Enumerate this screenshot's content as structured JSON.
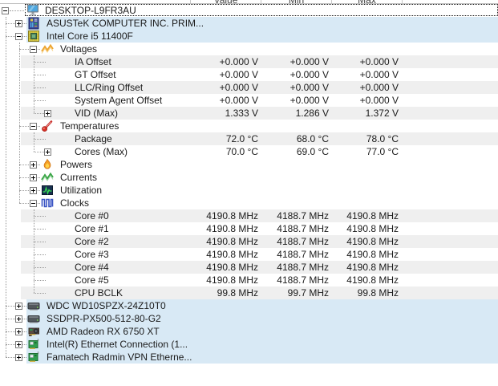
{
  "header": {
    "columns": [
      "Value",
      "Min",
      "Max"
    ]
  },
  "colors": {
    "row_highlight": "#d8e9f5",
    "row_stripe": "#efefef",
    "header_border": "#bdbdbd",
    "tree_line": "#9a9a9a",
    "focus_outline": "#1a1a1a"
  },
  "tree": {
    "rows": [
      {
        "level": 0,
        "expander": "minus",
        "icon": "monitor-icon",
        "label": "DESKTOP-L9FR3AU",
        "values": [],
        "selected": true
      },
      {
        "level": 1,
        "expander": "plus",
        "icon": "motherboard-icon",
        "label": "ASUSTeK COMPUTER INC. PRIM...",
        "values": []
      },
      {
        "level": 1,
        "expander": "minus",
        "icon": "cpu-icon",
        "label": "Intel Core i5 11400F",
        "values": []
      },
      {
        "level": 2,
        "expander": "minus",
        "icon": "voltage-icon",
        "label": "Voltages",
        "values": []
      },
      {
        "level": 3,
        "expander": null,
        "icon": null,
        "label": "IA Offset",
        "values": [
          "+0.000 V",
          "+0.000 V",
          "+0.000 V"
        ]
      },
      {
        "level": 3,
        "expander": null,
        "icon": null,
        "label": "GT Offset",
        "values": [
          "+0.000 V",
          "+0.000 V",
          "+0.000 V"
        ]
      },
      {
        "level": 3,
        "expander": null,
        "icon": null,
        "label": "LLC/Ring Offset",
        "values": [
          "+0.000 V",
          "+0.000 V",
          "+0.000 V"
        ]
      },
      {
        "level": 3,
        "expander": null,
        "icon": null,
        "label": "System Agent Offset",
        "values": [
          "+0.000 V",
          "+0.000 V",
          "+0.000 V"
        ]
      },
      {
        "level": 3,
        "expander": "plus",
        "icon": null,
        "label": "VID (Max)",
        "values": [
          "1.333 V",
          "1.286 V",
          "1.372 V"
        ]
      },
      {
        "level": 2,
        "expander": "minus",
        "icon": "thermometer-icon",
        "label": "Temperatures",
        "values": []
      },
      {
        "level": 3,
        "expander": null,
        "icon": null,
        "label": "Package",
        "values": [
          "72.0 °C",
          "68.0 °C",
          "78.0 °C"
        ]
      },
      {
        "level": 3,
        "expander": "plus",
        "icon": null,
        "label": "Cores (Max)",
        "values": [
          "70.0 °C",
          "69.0 °C",
          "77.0 °C"
        ]
      },
      {
        "level": 2,
        "expander": "plus",
        "icon": "flame-icon",
        "label": "Powers",
        "values": []
      },
      {
        "level": 2,
        "expander": "plus",
        "icon": "current-icon",
        "label": "Currents",
        "values": []
      },
      {
        "level": 2,
        "expander": "plus",
        "icon": "utilization-icon",
        "label": "Utilization",
        "values": []
      },
      {
        "level": 2,
        "expander": "minus",
        "icon": "clock-wave-icon",
        "label": "Clocks",
        "values": []
      },
      {
        "level": 3,
        "expander": null,
        "icon": null,
        "label": "Core #0",
        "values": [
          "4190.8 MHz",
          "4188.7 MHz",
          "4190.8 MHz"
        ]
      },
      {
        "level": 3,
        "expander": null,
        "icon": null,
        "label": "Core #1",
        "values": [
          "4190.8 MHz",
          "4188.7 MHz",
          "4190.8 MHz"
        ]
      },
      {
        "level": 3,
        "expander": null,
        "icon": null,
        "label": "Core #2",
        "values": [
          "4190.8 MHz",
          "4188.7 MHz",
          "4190.8 MHz"
        ]
      },
      {
        "level": 3,
        "expander": null,
        "icon": null,
        "label": "Core #3",
        "values": [
          "4190.8 MHz",
          "4188.7 MHz",
          "4190.8 MHz"
        ]
      },
      {
        "level": 3,
        "expander": null,
        "icon": null,
        "label": "Core #4",
        "values": [
          "4190.8 MHz",
          "4188.7 MHz",
          "4190.8 MHz"
        ]
      },
      {
        "level": 3,
        "expander": null,
        "icon": null,
        "label": "Core #5",
        "values": [
          "4190.8 MHz",
          "4188.7 MHz",
          "4190.8 MHz"
        ]
      },
      {
        "level": 3,
        "expander": null,
        "icon": null,
        "label": "CPU BCLK",
        "values": [
          "99.8 MHz",
          "99.7 MHz",
          "99.8 MHz"
        ]
      },
      {
        "level": 1,
        "expander": "plus",
        "icon": "hdd-icon",
        "label": "WDC WD10SPZX-24Z10T0",
        "values": []
      },
      {
        "level": 1,
        "expander": "plus",
        "icon": "hdd-icon",
        "label": "SSDPR-PX500-512-80-G2",
        "values": []
      },
      {
        "level": 1,
        "expander": "plus",
        "icon": "gpu-icon",
        "label": "AMD Radeon RX 6750 XT",
        "values": []
      },
      {
        "level": 1,
        "expander": "plus",
        "icon": "nic-icon",
        "label": "Intel(R) Ethernet Connection (1...",
        "values": []
      },
      {
        "level": 1,
        "expander": "plus",
        "icon": "nic-icon",
        "label": "Famatech Radmin VPN Etherne...",
        "values": []
      }
    ]
  }
}
